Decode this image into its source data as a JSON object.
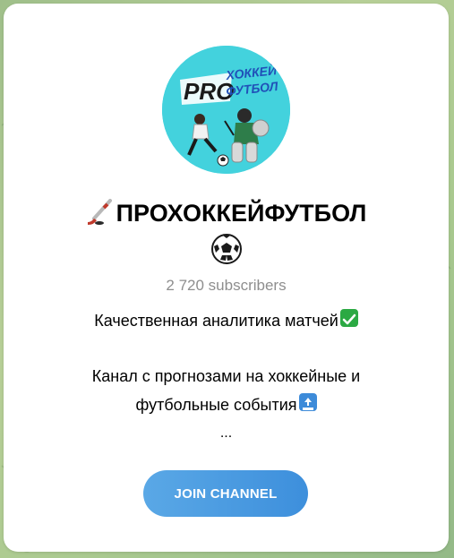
{
  "channel": {
    "title": "ПРОХОККЕЙФУТБОЛ",
    "title_icon": "hockey-stick-icon",
    "emoji_icon": "soccer-ball-icon",
    "subscribers": "2 720 subscribers",
    "avatar": {
      "logo_text_pro": "PRO",
      "logo_text_line1": "ХОККЕЙ",
      "logo_text_line2": "ФУТБОЛ",
      "background_color": "#43d2dd"
    }
  },
  "description": {
    "line1": "Качественная аналитика матчей",
    "line1_icon": "check-mark-icon",
    "line2": "Канал с прогнозами на хоккейные и",
    "line3": "футбольные события",
    "line3_icon": "top-arrow-icon",
    "line4": "..."
  },
  "actions": {
    "join_label": "JOIN CHANNEL",
    "join_color": "#4a9ae0"
  }
}
